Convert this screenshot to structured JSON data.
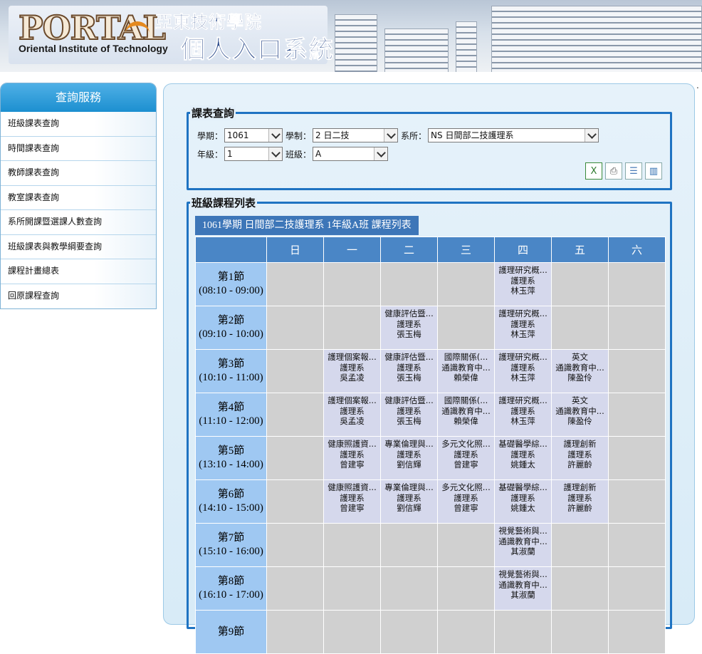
{
  "banner": {
    "portal_text": "PORTAL",
    "institute_en": "Oriental Institute of Technology",
    "school_name": "亞東技術學院",
    "system_name": "個人入口系統"
  },
  "dot": ".",
  "sidebar": {
    "title": "查詢服務",
    "items": [
      {
        "label": "班級課表查詢"
      },
      {
        "label": "時間課表查詢"
      },
      {
        "label": "教師課表查詢"
      },
      {
        "label": "教室課表查詢"
      },
      {
        "label": "系所開課暨選課人數查詢"
      },
      {
        "label": "班級課表與教學綱要查詢"
      },
      {
        "label": "課程計畫總表"
      },
      {
        "label": "回原課程查詢"
      }
    ]
  },
  "query": {
    "legend": "課表查詢",
    "year_label": "學期：",
    "year_value": "1061",
    "system_label": "學制：",
    "system_value": "2 日二技",
    "dept_label": "系所：",
    "dept_value": "NS 日間部二技護理系",
    "grade_label": "年級：",
    "grade_value": "1",
    "class_label": "班級：",
    "class_value": "A",
    "icons": [
      "excel-icon",
      "print-icon",
      "list-view-icon",
      "grid-view-icon"
    ]
  },
  "list": {
    "legend": "班級課程列表",
    "caption": "1061學期 日間部二技護理系 1年級A班 課程列表",
    "days": [
      "日",
      "一",
      "二",
      "三",
      "四",
      "五",
      "六"
    ],
    "periods": [
      {
        "name": "第1節",
        "time": "(08:10 - 09:00)",
        "cells": [
          null,
          null,
          null,
          null,
          [
            "護理研究概...",
            "護理系",
            "林玉萍"
          ],
          null,
          null
        ]
      },
      {
        "name": "第2節",
        "time": "(09:10 - 10:00)",
        "cells": [
          null,
          null,
          [
            "健康評估暨...",
            "護理系",
            "張玉梅"
          ],
          null,
          [
            "護理研究概...",
            "護理系",
            "林玉萍"
          ],
          null,
          null
        ]
      },
      {
        "name": "第3節",
        "time": "(10:10 - 11:00)",
        "cells": [
          null,
          [
            "護理個案報...",
            "護理系",
            "吳孟凌"
          ],
          [
            "健康評估暨...",
            "護理系",
            "張玉梅"
          ],
          [
            "國際關係(...",
            "通識教育中...",
            "賴榮偉"
          ],
          [
            "護理研究概...",
            "護理系",
            "林玉萍"
          ],
          [
            "英文",
            "通識教育中...",
            "陳盈伶"
          ],
          null
        ]
      },
      {
        "name": "第4節",
        "time": "(11:10 - 12:00)",
        "cells": [
          null,
          [
            "護理個案報...",
            "護理系",
            "吳孟凌"
          ],
          [
            "健康評估暨...",
            "護理系",
            "張玉梅"
          ],
          [
            "國際關係(...",
            "通識教育中...",
            "賴榮偉"
          ],
          [
            "護理研究概...",
            "護理系",
            "林玉萍"
          ],
          [
            "英文",
            "通識教育中...",
            "陳盈伶"
          ],
          null
        ]
      },
      {
        "name": "第5節",
        "time": "(13:10 - 14:00)",
        "cells": [
          null,
          [
            "健康照護資...",
            "護理系",
            "曾建寧"
          ],
          [
            "專業倫理與...",
            "護理系",
            "劉信輝"
          ],
          [
            "多元文化照...",
            "護理系",
            "曾建寧"
          ],
          [
            "基礎醫學綜...",
            "護理系",
            "姚鍾太"
          ],
          [
            "護理創新",
            "護理系",
            "許麗齡"
          ],
          null
        ]
      },
      {
        "name": "第6節",
        "time": "(14:10 - 15:00)",
        "cells": [
          null,
          [
            "健康照護資...",
            "護理系",
            "曾建寧"
          ],
          [
            "專業倫理與...",
            "護理系",
            "劉信輝"
          ],
          [
            "多元文化照...",
            "護理系",
            "曾建寧"
          ],
          [
            "基礎醫學綜...",
            "護理系",
            "姚鍾太"
          ],
          [
            "護理創新",
            "護理系",
            "許麗齡"
          ],
          null
        ]
      },
      {
        "name": "第7節",
        "time": "(15:10 - 16:00)",
        "cells": [
          null,
          null,
          null,
          null,
          [
            "視覺藝術與...",
            "通識教育中...",
            "其淑蘭"
          ],
          null,
          null
        ]
      },
      {
        "name": "第8節",
        "time": "(16:10 - 17:00)",
        "cells": [
          null,
          null,
          null,
          null,
          [
            "視覺藝術與...",
            "通識教育中...",
            "其淑蘭"
          ],
          null,
          null
        ]
      },
      {
        "name": "第9節",
        "time": "",
        "cells": [
          null,
          null,
          null,
          null,
          null,
          null,
          null
        ]
      }
    ]
  }
}
